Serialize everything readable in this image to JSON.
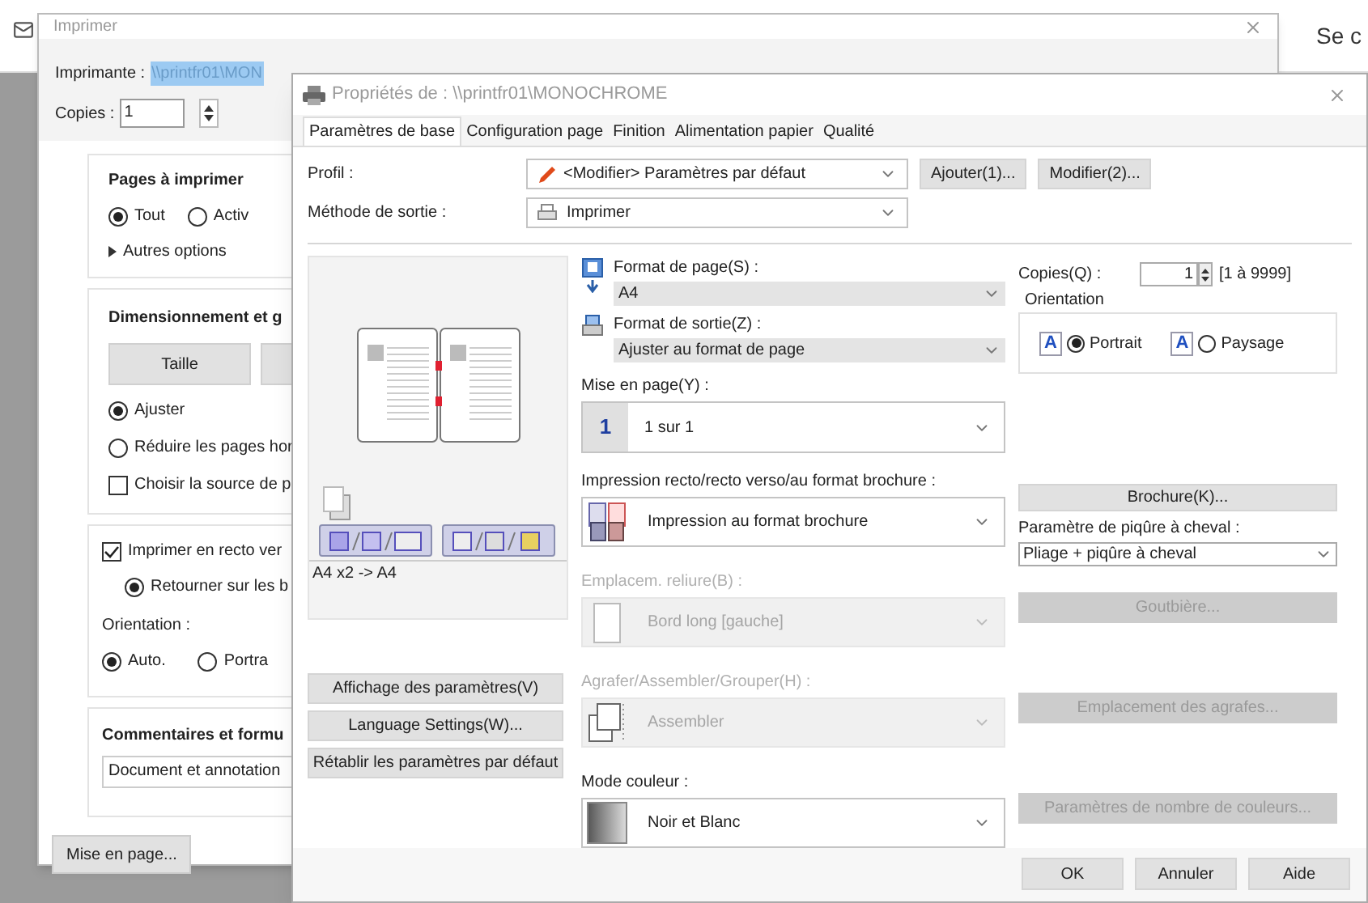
{
  "background_app": {
    "header_text": "Se c"
  },
  "print_dialog": {
    "title": "Imprimer",
    "printer": {
      "label": "Imprimante :",
      "value": "\\\\printfr01\\MON"
    },
    "copies": {
      "label": "Copies :",
      "value": "1"
    },
    "pages": {
      "heading": "Pages à imprimer",
      "options": [
        {
          "label": "Tout",
          "selected": true
        },
        {
          "label": "Activ",
          "selected": false
        }
      ],
      "more_options": "Autres options"
    },
    "sizing": {
      "heading": "Dimensionnement et g",
      "tab_label": "Taille",
      "options": [
        {
          "label": "Ajuster",
          "selected": true
        },
        {
          "label": "Réduire les pages hor",
          "selected": false
        }
      ],
      "paper_source": {
        "label": "Choisir la source de p",
        "checked": false
      }
    },
    "duplex": {
      "label": "Imprimer en recto ver",
      "checked": true,
      "flip": {
        "label": "Retourner sur les b",
        "selected": true
      },
      "orientation_label": "Orientation :",
      "orientation_options": [
        {
          "label": "Auto.",
          "selected": true
        },
        {
          "label": "Portra",
          "selected": false
        }
      ]
    },
    "comments": {
      "heading": "Commentaires et formu",
      "value": "Document et annotation"
    },
    "page_setup_button": "Mise en page..."
  },
  "properties_dialog": {
    "title": "Propriétés de : \\\\printfr01\\MONOCHROME",
    "tabs": [
      {
        "label": "Paramètres de base",
        "selected": true
      },
      {
        "label": "Configuration page",
        "selected": false
      },
      {
        "label": "Finition",
        "selected": false
      },
      {
        "label": "Alimentation papier",
        "selected": false
      },
      {
        "label": "Qualité",
        "selected": false
      }
    ],
    "profile": {
      "label": "Profil :",
      "value": "<Modifier> Paramètres par défaut"
    },
    "profile_buttons": [
      "Ajouter(1)...",
      "Modifier(2)..."
    ],
    "output_method": {
      "label": "Méthode de sortie :",
      "value": "Imprimer"
    },
    "preview": {
      "caption": "A4 x2 -> A4"
    },
    "left_buttons": [
      "Affichage des paramètres(V)",
      "Language Settings(W)...",
      "Rétablir les paramètres par défaut"
    ],
    "page_size": {
      "label": "Format de page(S) :",
      "value": "A4"
    },
    "output_size": {
      "label": "Format de sortie(Z) :",
      "value": "Ajuster au format de page"
    },
    "layout": {
      "label": "Mise en page(Y) :",
      "value": "1 sur 1",
      "icon_text": "1"
    },
    "print_type": {
      "label": "Impression recto/recto verso/au format brochure :",
      "value": "Impression au format brochure",
      "disabled": false
    },
    "binding": {
      "label": "Emplacem. reliure(B) :",
      "value": "Bord long [gauche]",
      "disabled": true
    },
    "finishing": {
      "label": "Agrafer/Assembler/Grouper(H) :",
      "value": "Assembler",
      "disabled": true
    },
    "color_mode": {
      "label": "Mode couleur :",
      "value": "Noir et Blanc",
      "disabled": false
    },
    "copies": {
      "label": "Copies(Q) :",
      "value": "1",
      "range": "[1 à 9999]"
    },
    "orientation": {
      "legend": "Orientation",
      "options": [
        {
          "label": "Portrait",
          "selected": true,
          "icon_letter": "A"
        },
        {
          "label": "Paysage",
          "selected": false,
          "icon_letter": "A"
        }
      ]
    },
    "booklet_button": {
      "label": "Brochure(K)...",
      "disabled": false
    },
    "saddle_stitch": {
      "label": "Paramètre de piqûre à cheval :",
      "value": "Pliage + piqûre à cheval"
    },
    "side_buttons": [
      {
        "label": "Goutbière...",
        "disabled": true
      },
      {
        "label": "Emplacement des agrafes...",
        "disabled": true
      },
      {
        "label": "Paramètres de nombre de couleurs...",
        "disabled": true
      }
    ],
    "footer_buttons": [
      "OK",
      "Annuler",
      "Aide"
    ]
  }
}
